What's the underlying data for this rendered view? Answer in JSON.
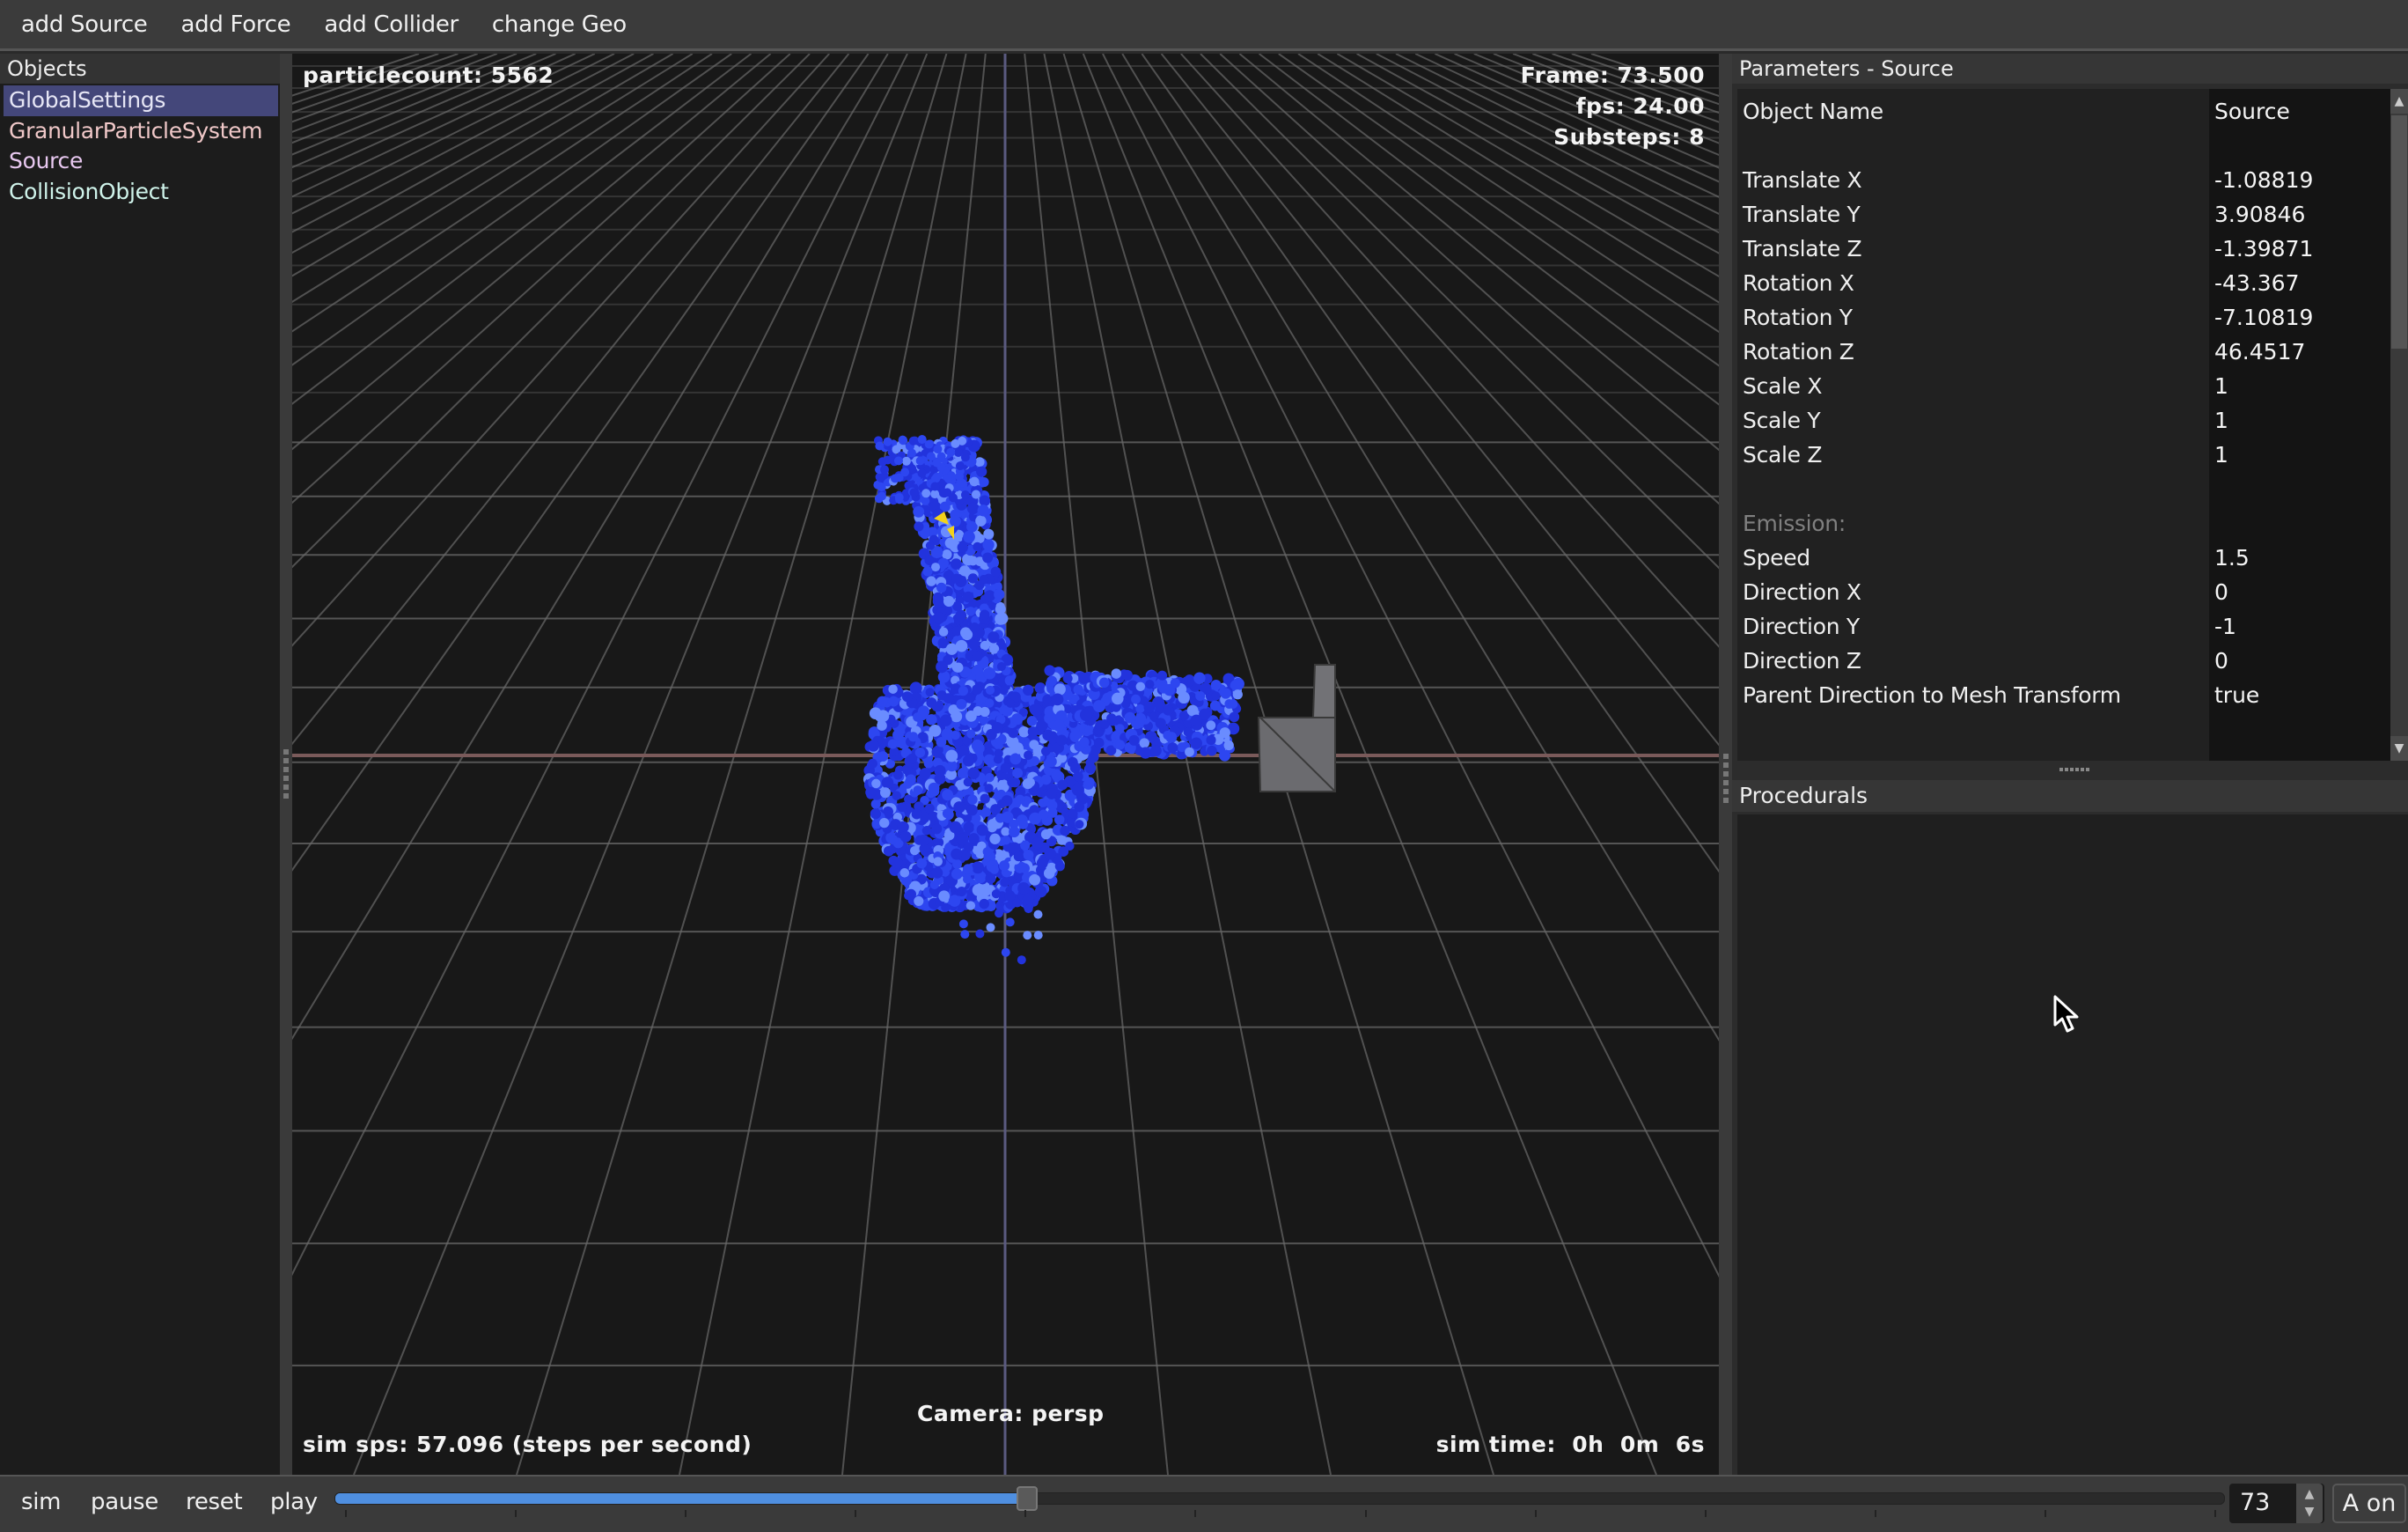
{
  "menu": {
    "items": [
      "add Source",
      "add Force",
      "add Collider",
      "change Geo"
    ]
  },
  "objects_panel": {
    "title": "Objects",
    "items": [
      {
        "label": "GlobalSettings",
        "color": "#e6e6f5",
        "selected": true
      },
      {
        "label": "GranularParticleSystem",
        "color": "#f0c8c8",
        "selected": false
      },
      {
        "label": "Source",
        "color": "#e8c8f0",
        "selected": false
      },
      {
        "label": "CollisionObject",
        "color": "#cff3ea",
        "selected": false
      }
    ]
  },
  "viewport": {
    "particle_count": "particlecount: 5562",
    "frame": "Frame: 73.500",
    "fps": "fps: 24.00",
    "substeps": "Substeps: 8",
    "camera": "Camera: persp",
    "sim_sps": "sim sps: 57.096 (steps per second)",
    "sim_time": "sim time:  0h  0m  6s",
    "colors": {
      "background": "#181818",
      "grid": "#6a6a6a",
      "x_axis": "#7a5a5a",
      "z_axis": "#5a5a80",
      "particles": "#2233dd",
      "particles_highlight": "#6a8cff",
      "collider": "#6b6b6f",
      "source_marker": "#f2d21c"
    }
  },
  "parameters_panel": {
    "title": "Parameters - Source",
    "rows": [
      {
        "name": "Object Name",
        "value": "Source"
      },
      {
        "name": "",
        "value": ""
      },
      {
        "name": "Translate X",
        "value": "-1.08819"
      },
      {
        "name": "Translate Y",
        "value": "3.90846"
      },
      {
        "name": "Translate Z",
        "value": "-1.39871"
      },
      {
        "name": "Rotation X",
        "value": "-43.367"
      },
      {
        "name": "Rotation Y",
        "value": "-7.10819"
      },
      {
        "name": "Rotation Z",
        "value": "46.4517"
      },
      {
        "name": "Scale X",
        "value": "1"
      },
      {
        "name": "Scale Y",
        "value": "1"
      },
      {
        "name": "Scale Z",
        "value": "1"
      },
      {
        "name": "",
        "value": ""
      },
      {
        "name": "Emission:",
        "value": "",
        "section": true
      },
      {
        "name": "Speed",
        "value": "1.5"
      },
      {
        "name": "Direction X",
        "value": "0"
      },
      {
        "name": "Direction Y",
        "value": "-1"
      },
      {
        "name": "Direction Z",
        "value": "0"
      },
      {
        "name": "Parent Direction to Mesh Transform",
        "value": "true"
      }
    ],
    "scroll_up_icon": "▲",
    "scroll_down_icon": "▼"
  },
  "procedurals_panel": {
    "title": "Procedurals"
  },
  "bottom_bar": {
    "sim_label": "sim",
    "pause_label": "pause",
    "reset_label": "reset",
    "play_label": "play",
    "timeline_progress": 0.366,
    "timeline_tick_count": 12,
    "frame_value": "73",
    "spin_up_icon": "▲",
    "spin_down_icon": "▼",
    "a_on_label": "A on"
  }
}
